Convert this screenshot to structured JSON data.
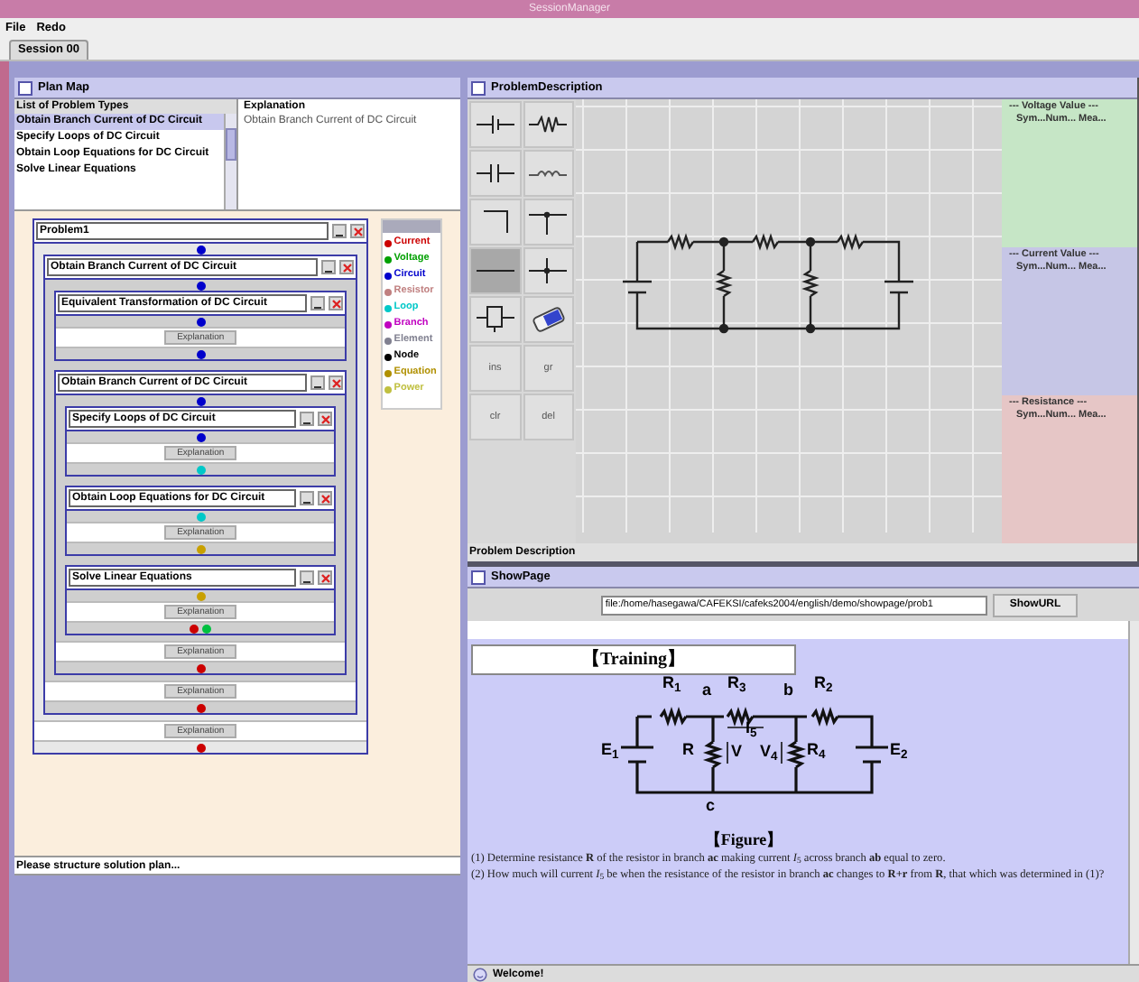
{
  "window": {
    "title": "SessionManager"
  },
  "menu": [
    "File",
    "Redo"
  ],
  "tabs": [
    {
      "label": "Session 00",
      "selected": true
    }
  ],
  "plan_map": {
    "title": "Plan Map",
    "list_header": "List of Problem Types",
    "problem_types": [
      {
        "label": "Obtain Branch Current of DC Circuit",
        "selected": true
      },
      {
        "label": "Specify Loops of DC Circuit",
        "selected": false
      },
      {
        "label": "Obtain Loop Equations for DC Circuit",
        "selected": false
      },
      {
        "label": "Solve Linear Equations",
        "selected": false
      }
    ],
    "explanation_header": "Explanation",
    "explanation": "Obtain Branch Current of DC Circuit",
    "tree": {
      "title": "Problem1",
      "button": "Explanation",
      "in_links": [
        {
          "color": "#0000cc"
        }
      ],
      "out_links": [
        {
          "color": "#cc0000"
        }
      ],
      "children": [
        {
          "title": "Obtain Branch Current of DC Circuit",
          "button": "Explanation",
          "in_links": [
            {
              "color": "#0000cc"
            }
          ],
          "out_links": [
            {
              "color": "#cc0000"
            }
          ],
          "children": [
            {
              "title": "Equivalent Transformation of DC Circuit",
              "button": "Explanation",
              "in_links": [
                {
                  "color": "#0000cc"
                }
              ],
              "out_links": [
                {
                  "color": "#0000cc"
                }
              ]
            },
            {
              "title": "Obtain Branch Current of DC Circuit",
              "button": "Explanation",
              "in_links": [
                {
                  "color": "#0000cc"
                }
              ],
              "out_links": [
                {
                  "color": "#cc0000"
                }
              ],
              "children": [
                {
                  "title": "Specify Loops of DC Circuit",
                  "button": "Explanation",
                  "in_links": [
                    {
                      "color": "#0000cc"
                    }
                  ],
                  "out_links": [
                    {
                      "color": "#00c8c8"
                    }
                  ]
                },
                {
                  "title": "Obtain Loop Equations for DC Circuit",
                  "button": "Explanation",
                  "in_links": [
                    {
                      "color": "#00c8c8"
                    }
                  ],
                  "out_links": [
                    {
                      "color": "#c8a000"
                    }
                  ]
                },
                {
                  "title": "Solve Linear Equations",
                  "button": "Explanation",
                  "in_links": [
                    {
                      "color": "#c8a000"
                    }
                  ],
                  "out_links": [
                    {
                      "color": "#cc0000"
                    },
                    {
                      "color": "#00c040"
                    }
                  ]
                }
              ]
            }
          ]
        }
      ]
    },
    "legend": [
      {
        "label": "Current",
        "color": "#cc0000"
      },
      {
        "label": "Voltage",
        "color": "#00a000"
      },
      {
        "label": "Circuit",
        "color": "#0000cc"
      },
      {
        "label": "Resistor",
        "color": "#c08080"
      },
      {
        "label": "Loop",
        "color": "#00c8c8"
      },
      {
        "label": "Branch",
        "color": "#c000c0"
      },
      {
        "label": "Element",
        "color": "#808090"
      },
      {
        "label": "Node",
        "color": "#000000"
      },
      {
        "label": "Equation",
        "color": "#b09000"
      },
      {
        "label": "Power",
        "color": "#c0c040"
      }
    ],
    "status": "Please structure solution plan..."
  },
  "problem_description": {
    "title": "ProblemDescription",
    "palette": [
      {
        "kind": "battery",
        "selected": false
      },
      {
        "kind": "resistor",
        "selected": false
      },
      {
        "kind": "capacitor",
        "selected": false
      },
      {
        "kind": "inductor",
        "selected": false
      },
      {
        "kind": "corner",
        "selected": false
      },
      {
        "kind": "tee",
        "selected": false
      },
      {
        "kind": "wire",
        "selected": true
      },
      {
        "kind": "cross",
        "selected": false
      },
      {
        "kind": "component",
        "selected": false
      },
      {
        "kind": "eraser",
        "selected": false
      },
      {
        "kind": "text",
        "label": "ins",
        "selected": false
      },
      {
        "kind": "text",
        "label": "gr",
        "selected": false
      },
      {
        "kind": "text",
        "label": "clr",
        "selected": false
      },
      {
        "kind": "text",
        "label": "del",
        "selected": false
      }
    ],
    "value_panels": [
      {
        "title": "--- Voltage Value ---",
        "columns": "Sym...Num... Mea...",
        "color": "#c6e6c6"
      },
      {
        "title": "--- Current Value ---",
        "columns": "Sym...Num... Mea...",
        "color": "#c6c6e6"
      },
      {
        "title": "--- Resistance ---",
        "columns": "Sym...Num... Mea...",
        "color": "#e6c6c6"
      }
    ],
    "footer": "Problem Description"
  },
  "show_page": {
    "title": "ShowPage",
    "url": "file:/home/hasegawa/CAFEKSI/cafeks2004/english/demo/showpage/prob1",
    "button": "ShowURL",
    "heading": "【Training】",
    "figure_labels": [
      "R$_{1}$",
      "a",
      "R$_{3}$",
      "b",
      "R$_{2}$",
      "E$_{1}$",
      "R",
      "V",
      "I$_{5}$",
      "V$_{4}$",
      "R$_{4}$",
      "E$_{2}$",
      "c"
    ],
    "caption": "【Figure】",
    "questions": [
      "(1) Determine resistance **R** of the resistor in branch **ac** making current *I*$_{5}$ across branch **ab** equal to zero.",
      "(2) How much will current *I*$_{5}$ be when the resistance of the resistor in branch **ac** changes to **R+r** from **R**, that which was determined in (1)?"
    ]
  },
  "status_bar": "Welcome!"
}
